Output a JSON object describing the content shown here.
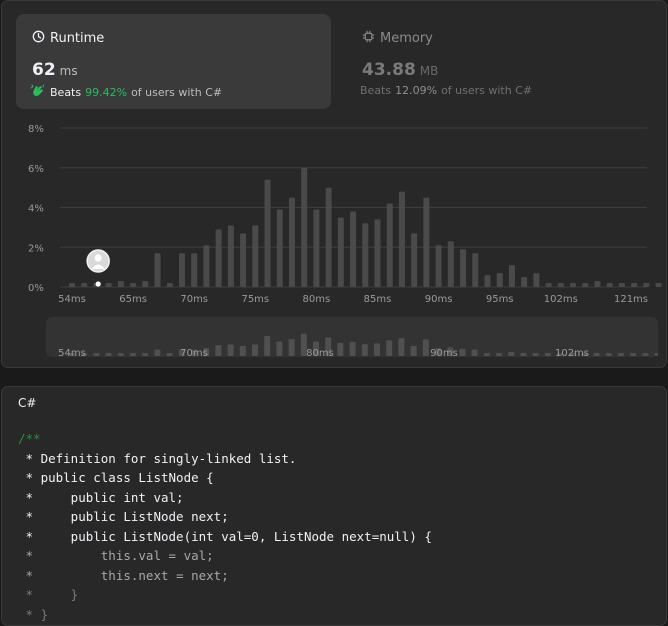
{
  "runtime_card": {
    "title": "Runtime",
    "icon": "clock-icon",
    "value": "62",
    "unit": "ms",
    "beats_label": "Beats",
    "beats_percent": "99.42%",
    "beats_suffix": "of users with C#",
    "accent_color": "#2cbb5d"
  },
  "memory_card": {
    "title": "Memory",
    "icon": "chip-icon",
    "value": "43.88",
    "unit": "MB",
    "beats_label": "Beats",
    "beats_percent": "12.09%",
    "beats_suffix": "of users with C#"
  },
  "chart_data": {
    "type": "bar",
    "title": "",
    "xlabel": "",
    "ylabel": "",
    "ylim": [
      0,
      8
    ],
    "y_ticks": [
      "8%",
      "6%",
      "4%",
      "2%",
      "0%"
    ],
    "x_ticks": [
      "54ms",
      "65ms",
      "70ms",
      "75ms",
      "80ms",
      "85ms",
      "90ms",
      "95ms",
      "102ms",
      "121ms"
    ],
    "values": [
      0.2,
      0.2,
      0.2,
      0.2,
      0.3,
      0.2,
      0.3,
      1.7,
      0.2,
      1.7,
      1.7,
      2.1,
      2.9,
      3.1,
      2.7,
      3.1,
      5.4,
      3.9,
      4.5,
      6.0,
      3.9,
      5.0,
      3.5,
      3.8,
      3.2,
      3.4,
      4.2,
      4.8,
      2.7,
      4.5,
      2.1,
      2.3,
      1.9,
      1.7,
      0.6,
      0.7,
      1.1,
      0.5,
      0.7,
      0.2,
      0.2,
      0.2,
      0.2,
      0.3,
      0.2,
      0.2,
      0.2,
      0.2,
      0.2
    ],
    "current_bar_index": 3,
    "grid": true,
    "bar_color": "#4a4a4a",
    "overview_labels": [
      "54ms",
      "70ms",
      "80ms",
      "90ms",
      "102ms"
    ]
  },
  "code_panel": {
    "language": "C#",
    "lines": [
      "/**",
      " * Definition for singly-linked list.",
      " * public class ListNode {",
      " *     public int val;",
      " *     public ListNode next;",
      " *     public ListNode(int val=0, ListNode next=null) {",
      " *         this.val = val;",
      " *         this.next = next;",
      " *     }",
      " * }"
    ]
  }
}
